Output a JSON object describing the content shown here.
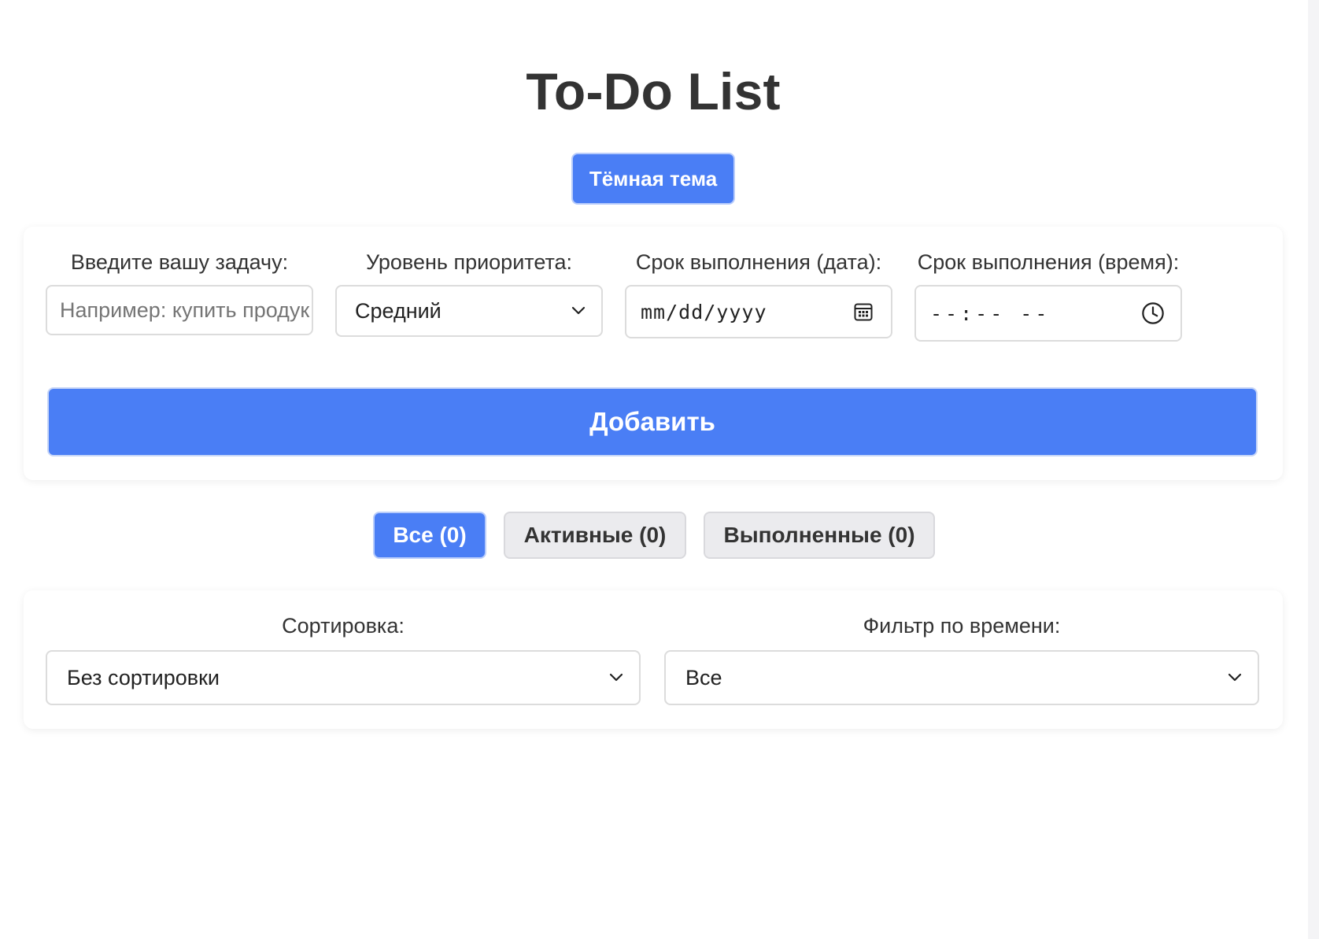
{
  "header": {
    "title": "To-Do List",
    "theme_button": "Тёмная тема"
  },
  "add_form": {
    "task": {
      "label": "Введите вашу задачу:",
      "placeholder": "Например: купить продук"
    },
    "priority": {
      "label": "Уровень приоритета:",
      "selected": "Средний"
    },
    "due_date": {
      "label": "Срок выполнения (дата):",
      "value": "mm/dd/yyyy"
    },
    "due_time": {
      "label": "Срок выполнения (время):",
      "value": "--:-- --"
    },
    "add_button": "Добавить"
  },
  "filters": {
    "all": "Все (0)",
    "active": "Активные (0)",
    "completed": "Выполненные (0)",
    "selected": "all"
  },
  "sort_panel": {
    "sort": {
      "label": "Сортировка:",
      "selected": "Без сортировки"
    },
    "time_filter": {
      "label": "Фильтр по времени:",
      "selected": "Все"
    }
  },
  "colors": {
    "accent": "#4a7ef5",
    "text": "#333333",
    "inactive_button": "#ebebee",
    "border": "#dcdcdc"
  },
  "icons": [
    "chevron-down-icon",
    "calendar-icon",
    "clock-icon"
  ]
}
